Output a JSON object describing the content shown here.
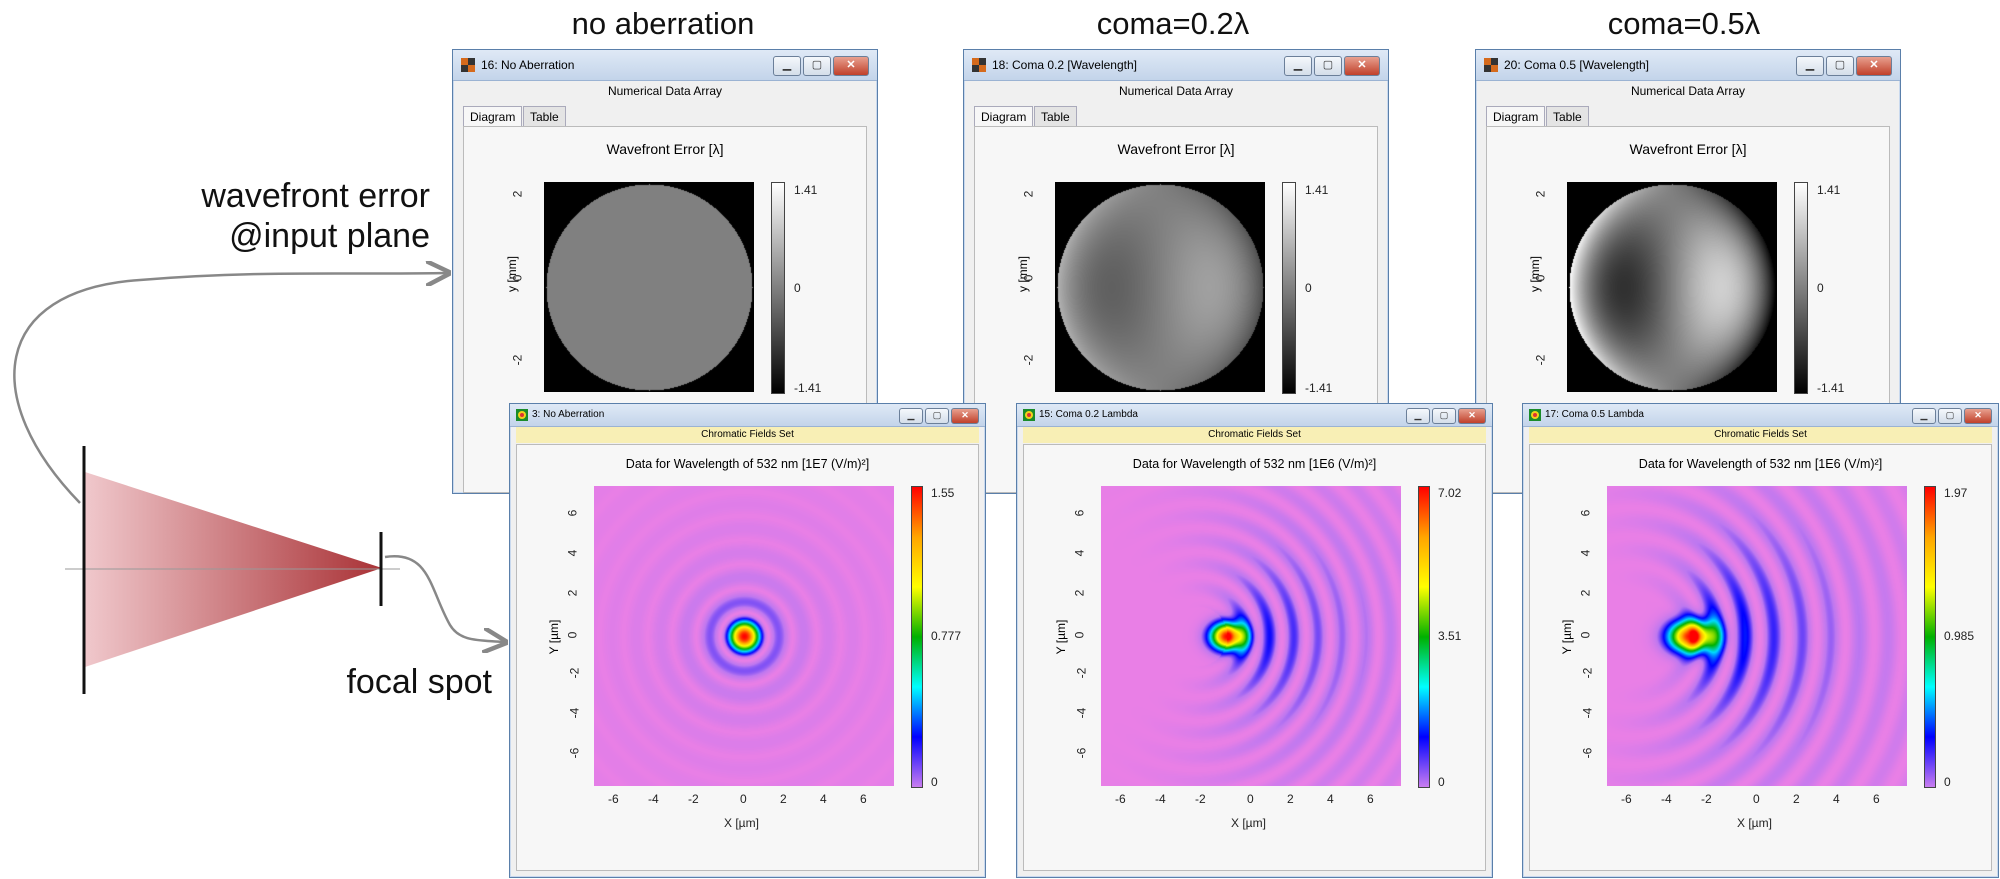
{
  "columns": [
    {
      "title": "no aberration"
    },
    {
      "title": "coma=0.2λ"
    },
    {
      "title": "coma=0.5λ"
    }
  ],
  "annotations": {
    "wavefront_line1": "wavefront error",
    "wavefront_line2": "@input plane",
    "focal": "focal spot"
  },
  "top_windows": [
    {
      "title": "16: No Aberration",
      "subtitle": "Numerical Data Array",
      "tabs": [
        "Diagram",
        "Table"
      ],
      "plot_title": "Wavefront Error [λ]",
      "ylabel": "y [mm]",
      "yticks": [
        "2",
        "0",
        "-2"
      ],
      "cbar": [
        "1.41",
        "0",
        "-1.41"
      ],
      "coma": 0
    },
    {
      "title": "18: Coma 0.2 [Wavelength]",
      "subtitle": "Numerical Data Array",
      "tabs": [
        "Diagram",
        "Table"
      ],
      "plot_title": "Wavefront Error [λ]",
      "ylabel": "y [mm]",
      "yticks": [
        "2",
        "0",
        "-2"
      ],
      "cbar": [
        "1.41",
        "0",
        "-1.41"
      ],
      "coma": 0.2
    },
    {
      "title": "20: Coma 0.5 [Wavelength]",
      "subtitle": "Numerical Data Array",
      "tabs": [
        "Diagram",
        "Table"
      ],
      "plot_title": "Wavefront Error [λ]",
      "ylabel": "y [mm]",
      "yticks": [
        "2",
        "0",
        "-2"
      ],
      "cbar": [
        "1.41",
        "0",
        "-1.41"
      ],
      "coma": 0.5
    }
  ],
  "bottom_windows": [
    {
      "title": "3: No Aberration",
      "subtitle": "Chromatic Fields Set",
      "plot_title": "Data for Wavelength of 532 nm  [1E7 (V/m)²]",
      "xlabel": "X [µm]",
      "ylabel": "Y [µm]",
      "ticks": [
        "-6",
        "-4",
        "-2",
        "0",
        "2",
        "4",
        "6"
      ],
      "cbar": [
        "1.55",
        "0.777",
        "0"
      ],
      "coma": 0
    },
    {
      "title": "15: Coma 0.2 Lambda",
      "subtitle": "Chromatic Fields Set",
      "plot_title": "Data for Wavelength of 532 nm  [1E6 (V/m)²]",
      "xlabel": "X [µm]",
      "ylabel": "Y [µm]",
      "ticks": [
        "-6",
        "-4",
        "-2",
        "0",
        "2",
        "4",
        "6"
      ],
      "cbar": [
        "7.02",
        "3.51",
        "0"
      ],
      "coma": 0.2
    },
    {
      "title": "17: Coma 0.5 Lambda",
      "subtitle": "Chromatic Fields Set",
      "plot_title": "Data for Wavelength of 532 nm  [1E6 (V/m)²]",
      "xlabel": "X [µm]",
      "ylabel": "Y [µm]",
      "ticks": [
        "-6",
        "-4",
        "-2",
        "0",
        "2",
        "4",
        "6"
      ],
      "cbar": [
        "1.97",
        "0.985",
        "0"
      ],
      "coma": 0.5
    }
  ],
  "colors": {
    "beam_start": "#f0c8cc",
    "beam_end": "#a93236",
    "arrow": "#888888",
    "field_bg": "#e97fe6"
  }
}
